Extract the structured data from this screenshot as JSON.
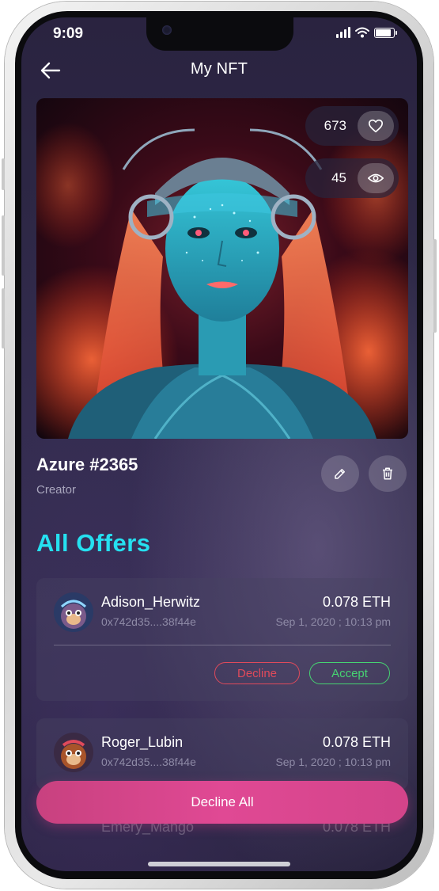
{
  "status_bar": {
    "time": "9:09"
  },
  "header": {
    "title": "My NFT"
  },
  "nft": {
    "likes": "673",
    "views": "45",
    "name": "Azure #2365",
    "creator_label": "Creator"
  },
  "offers": {
    "title": "All Offers",
    "items": [
      {
        "user": "Adison_Herwitz",
        "address": "0x742d35....38f44e",
        "amount": "0.078 ETH",
        "date": "Sep 1, 2020 ; 10:13 pm",
        "decline_label": "Decline",
        "accept_label": "Accept"
      },
      {
        "user": "Roger_Lubin",
        "address": "0x742d35....38f44e",
        "amount": "0.078 ETH",
        "date": "Sep 1, 2020 ; 10:13 pm"
      },
      {
        "user": "Emery_Mango",
        "amount": "0.078 ETH"
      }
    ]
  },
  "footer": {
    "decline_all_label": "Decline All"
  },
  "colors": {
    "accent": "#25e0f0",
    "decline": "#e04a5b",
    "accept": "#46d472",
    "primary_button": "#d3448a",
    "background": "#2f2a48"
  }
}
